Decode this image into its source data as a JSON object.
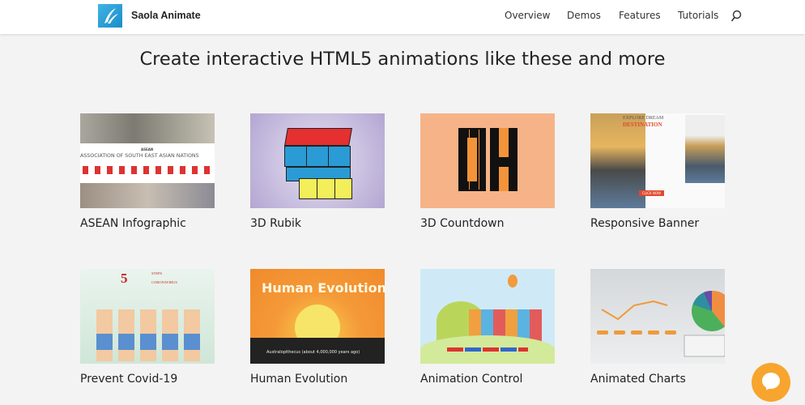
{
  "header": {
    "brand": "Saola Animate",
    "nav": [
      "Overview",
      "Demos",
      "Features",
      "Tutorials"
    ]
  },
  "page_title": "Create interactive HTML5 animations like these and more",
  "cards": [
    {
      "label": "ASEAN Infographic",
      "thumb_text": [
        "ASEAN",
        "ASSOCIATION OF SOUTH EAST ASIAN NATIONS"
      ]
    },
    {
      "label": "3D Rubik"
    },
    {
      "label": "3D Countdown"
    },
    {
      "label": "Responsive Banner",
      "thumb_text": [
        "EXPLORE DREAM",
        "DESTINATION",
        "CLICK NOW"
      ]
    },
    {
      "label": "Prevent Covid-19",
      "thumb_text": [
        "5",
        "STEPS",
        "CORONAVIRUS"
      ]
    },
    {
      "label": "Human Evolution",
      "thumb_text": [
        "Human Evolution",
        "Australopithecus (about 4,000,000 years ago)"
      ]
    },
    {
      "label": "Animation Control"
    },
    {
      "label": "Animated Charts"
    }
  ],
  "colors": {
    "accent": "#f7a52e",
    "background": "#f3f3f3"
  }
}
